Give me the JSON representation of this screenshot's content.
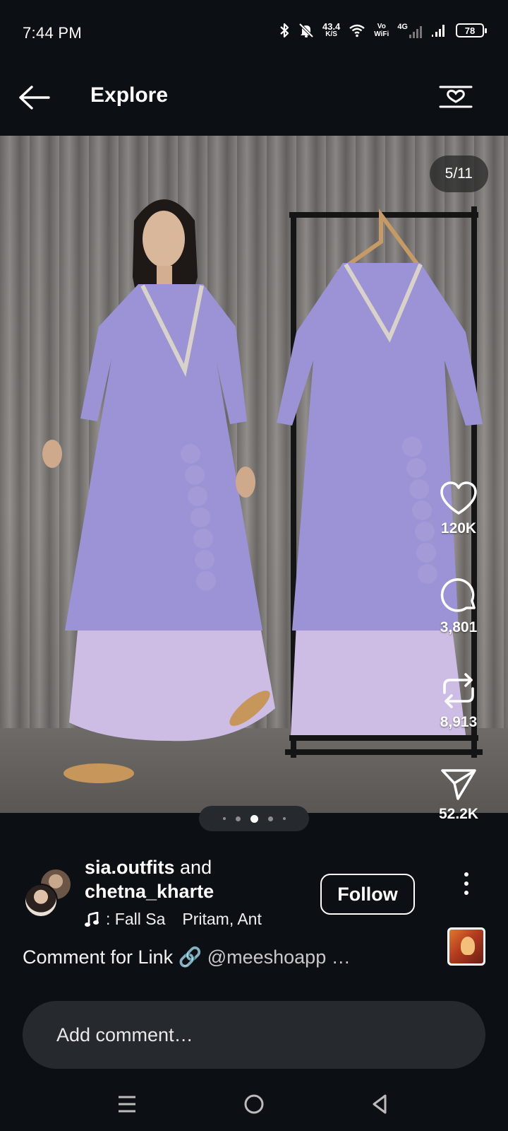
{
  "status_bar": {
    "time": "7:44 PM",
    "net_speed_value": "43.4",
    "net_speed_unit": "K/S",
    "volte_top": "Vo",
    "volte_bottom": "WiFi",
    "network_type": "4G",
    "battery": "78",
    "icons": [
      "bluetooth-icon",
      "mute-bell-icon",
      "wifi-icon",
      "signal-icon",
      "battery-icon"
    ]
  },
  "header": {
    "title": "Explore",
    "back_icon": "arrow-left-icon",
    "filter_icon": "heart-sliders-icon"
  },
  "post": {
    "image_counter": "5/11",
    "carousel": {
      "dot_count": 5,
      "active_index": 2
    },
    "actions": {
      "like_count": "120K",
      "comment_count": "3,801",
      "repost_count": "8,913",
      "share_count": "52.2K"
    },
    "authors": {
      "first": "sia.outfits",
      "joiner": "and",
      "second": "chetna_kharte"
    },
    "music": {
      "track": ": Fall Sa",
      "artist": "Pritam, Ant"
    },
    "follow_label": "Follow",
    "caption_text": "Comment for Link 🔗 ",
    "caption_mention": "@meeshoapp …"
  },
  "comment_input": {
    "placeholder": "Add comment…"
  },
  "navbar": {
    "icons": [
      "menu-icon",
      "home-circle-icon",
      "back-triangle-icon"
    ]
  },
  "colors": {
    "background": "#0c1014",
    "surface": "#262a2e",
    "text": "#ffffff",
    "kurta_lavender": "#9b92d6",
    "palazzo_lilac": "#c9b8e2"
  }
}
